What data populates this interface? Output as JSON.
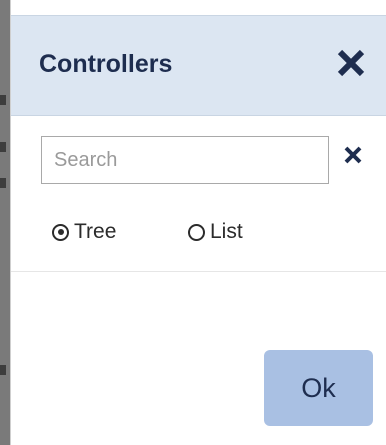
{
  "dialog": {
    "title": "Controllers",
    "close_icon": "close-icon",
    "accent_color": "#1e2d4f",
    "header_color": "#dce6f2"
  },
  "search": {
    "placeholder": "Search",
    "value": "",
    "clear_icon": "clear-icon"
  },
  "view_mode": {
    "options": [
      {
        "label": "Tree",
        "selected": true
      },
      {
        "label": "List",
        "selected": false
      }
    ]
  },
  "footer": {
    "ok_label": "Ok",
    "ok_color": "#a9c0e3"
  }
}
